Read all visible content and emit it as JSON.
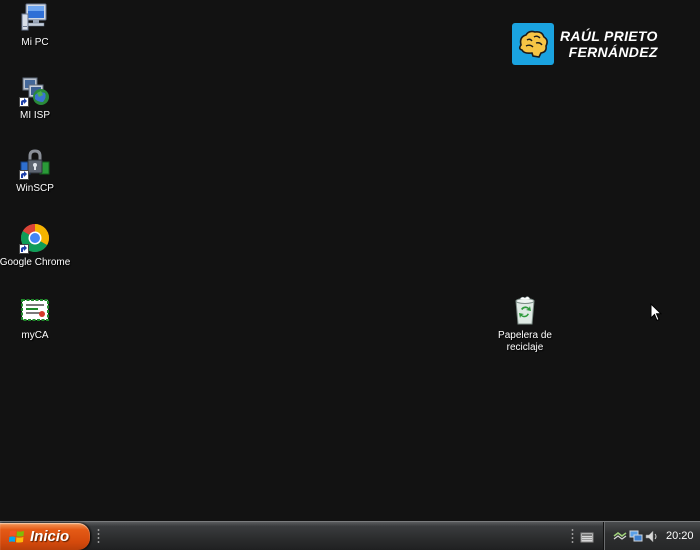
{
  "desktop": {
    "icons": [
      {
        "label": "Mi PC",
        "icon": "computer-icon"
      },
      {
        "label": "MI ISP",
        "icon": "network-globe-icon"
      },
      {
        "label": "WinSCP",
        "icon": "winscp-icon"
      },
      {
        "label": "Google Chrome",
        "icon": "chrome-icon"
      },
      {
        "label": "myCA",
        "icon": "certificate-icon"
      },
      {
        "label": "Papelera de reciclaje",
        "icon": "recycle-bin-icon"
      }
    ],
    "logo": {
      "line1": "RAÚL PRIETO",
      "line2": "FERNÁNDEZ",
      "badge_color": "#1aa3e0",
      "icon": "brain-icon"
    },
    "background_color": "#121212"
  },
  "taskbar": {
    "start_label": "Inicio",
    "start_color": "#e45a16",
    "clock": "20:20",
    "tray_icons": [
      "network-cable-icon",
      "network-monitor-icon",
      "speaker-icon"
    ]
  }
}
